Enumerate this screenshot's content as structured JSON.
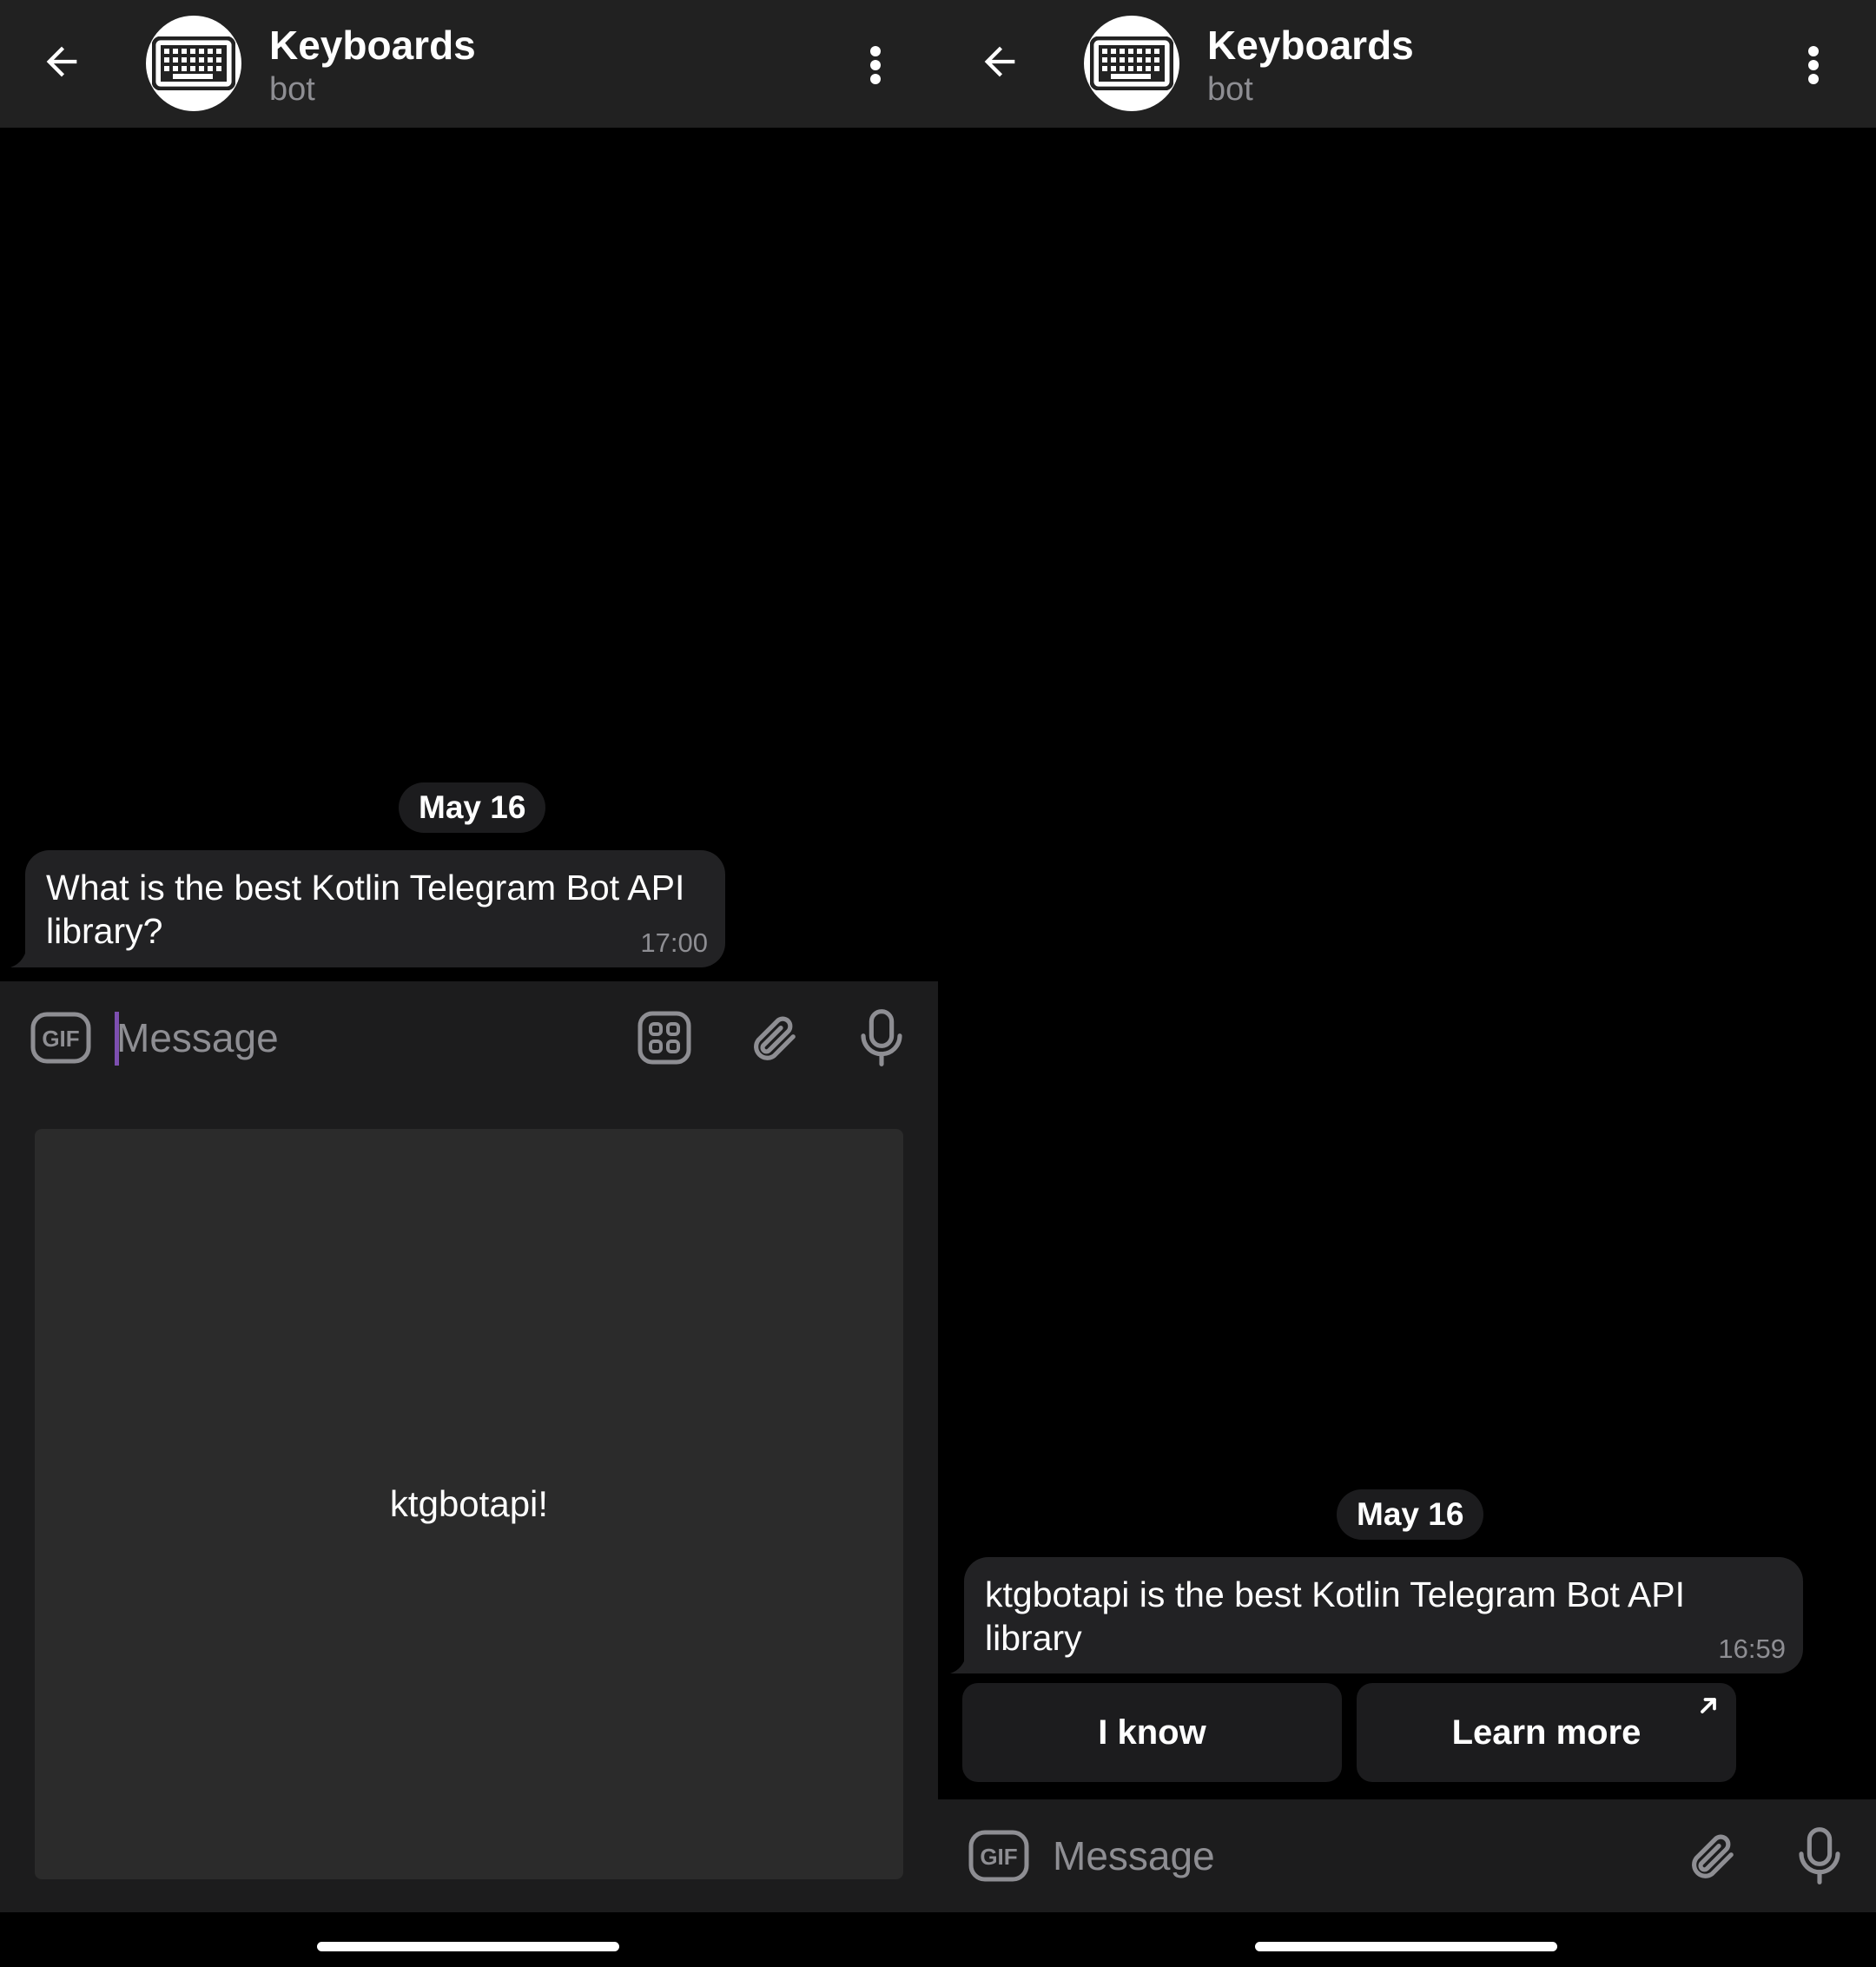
{
  "left": {
    "header": {
      "title": "Keyboards",
      "subtitle": "bot"
    },
    "date": "May 16",
    "message": {
      "text": "What is the best Kotlin Telegram Bot API library?",
      "time": "17:00"
    },
    "input": {
      "placeholder": "Message",
      "value": ""
    },
    "reply_keyboard": {
      "buttons": [
        "ktgbotapi!"
      ]
    }
  },
  "right": {
    "header": {
      "title": "Keyboards",
      "subtitle": "bot"
    },
    "date": "May 16",
    "message": {
      "text": "ktgbotapi is the best Kotlin Telegram Bot API library",
      "time": "16:59"
    },
    "inline_keyboard": {
      "buttons": [
        "I know",
        "Learn more"
      ]
    },
    "input": {
      "placeholder": "Message",
      "value": ""
    }
  },
  "icons": {
    "back": "arrow-left-icon",
    "avatar": "keyboard-icon",
    "menu": "more-vertical-icon",
    "gif": "gif-icon",
    "bot_keyboard": "grid-icon",
    "attach": "paperclip-icon",
    "mic": "microphone-icon",
    "external": "external-link-arrow-icon"
  },
  "colors": {
    "header_bg": "#212121",
    "chat_bg": "#000000",
    "bubble_bg": "#222224",
    "input_bg": "#1c1c1d",
    "keyboard_button_bg": "#2b2b2b",
    "caret": "#7d4fb0",
    "muted_text": "#8e8e93"
  }
}
